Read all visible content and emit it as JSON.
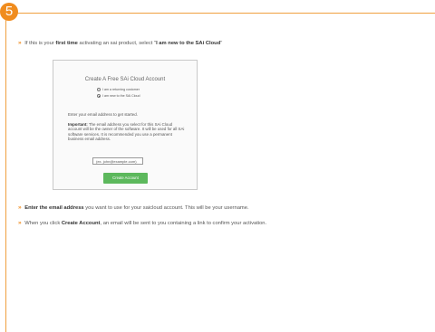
{
  "step_number": "5",
  "intro": {
    "chevron": "»",
    "text_before": "If this is your ",
    "bold_1": "first time",
    "text_middle": " activating an sai product, select \"",
    "bold_2": "I am new to the SAi Cloud",
    "text_after": "\""
  },
  "card": {
    "title": "Create A Free SAi Cloud Account",
    "option_returning": "I am a returning customer",
    "option_new": "I am new to the SAi Cloud",
    "prompt": "Enter your email address to get started.",
    "important_label": "Important:",
    "important_text": " The email address you select for this SAi Cloud account will be the owner of the software. It will be used for all SAi software services. It is recommended you use a permanent business email address.",
    "email_placeholder": "(ex. john@example.com)",
    "button_label": "Create Account"
  },
  "bullets": [
    {
      "chevron": "»",
      "bold": "Enter the email address",
      "text": " you want to use for your saicloud account. This will be your username."
    },
    {
      "chevron": "»",
      "text_before": "When you click ",
      "bold": "Create Account",
      "text": ", an email will be sent to you containing a link to confirm your activation."
    }
  ]
}
